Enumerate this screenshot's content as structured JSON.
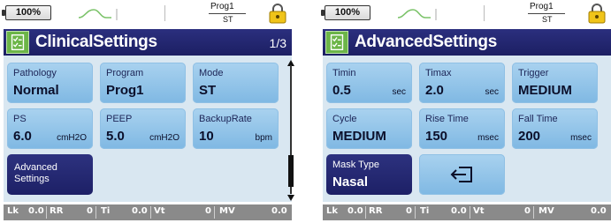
{
  "status": {
    "battery": "100%",
    "program": "Prog1",
    "mode": "ST"
  },
  "left": {
    "title": "ClinicalSettings",
    "page": "1/3",
    "tiles": {
      "pathology": {
        "label": "Pathology",
        "value": "Normal"
      },
      "program": {
        "label": "Program",
        "value": "Prog1"
      },
      "mode": {
        "label": "Mode",
        "value": "ST"
      },
      "ps": {
        "label": "PS",
        "value": "6.0",
        "unit": "cmH2O"
      },
      "peep": {
        "label": "PEEP",
        "value": "5.0",
        "unit": "cmH2O"
      },
      "backup_rate": {
        "label": "BackupRate",
        "value": "10",
        "unit": "bpm"
      },
      "advanced": {
        "label": "Advanced Settings"
      }
    }
  },
  "right": {
    "title": "AdvancedSettings",
    "tiles": {
      "timin": {
        "label": "Timin",
        "value": "0.5",
        "unit": "sec"
      },
      "timax": {
        "label": "Timax",
        "value": "2.0",
        "unit": "sec"
      },
      "trigger": {
        "label": "Trigger",
        "value": "MEDIUM"
      },
      "cycle": {
        "label": "Cycle",
        "value": "MEDIUM"
      },
      "rise_time": {
        "label": "Rise Time",
        "value": "150",
        "unit": "msec"
      },
      "fall_time": {
        "label": "Fall Time",
        "value": "200",
        "unit": "msec"
      },
      "mask_type": {
        "label": "Mask Type",
        "value": "Nasal"
      }
    }
  },
  "footer": {
    "lk_label": "Lk",
    "lk_value": "0.0",
    "rr_label": "RR",
    "rr_value": "0",
    "ti_label": "Ti",
    "ti_value": "0.0",
    "vt_label": "Vt",
    "vt_value": "0",
    "mv_label": "MV",
    "mv_value": "0.0",
    "mv_value_truncated": "0.0"
  },
  "colors": {
    "title_bar": "#2b2f7e",
    "tile": "#a9d2ef",
    "panel": "#d9e7f1",
    "footer": "#8a8a8a",
    "icon_green": "#6cb548",
    "lock_yellow": "#f0c419"
  },
  "icons": {
    "settings_icon": "clipboard-checklist-icon",
    "lock_icon": "padlock-icon",
    "wave_icon": "breath-wave-icon",
    "back_icon": "return-arrow-icon"
  }
}
